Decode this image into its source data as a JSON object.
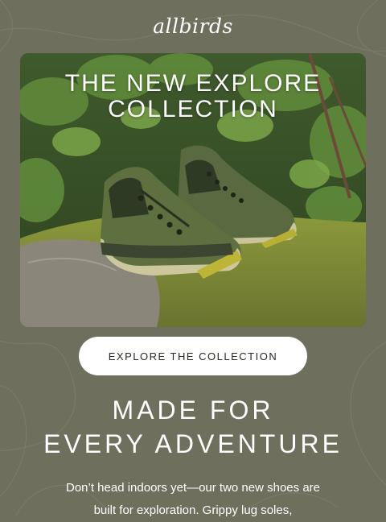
{
  "brand": {
    "logo_text": "allbirds"
  },
  "hero": {
    "title_line1": "THE NEW EXPLORE",
    "title_line2": "COLLECTION",
    "image": "green-trail-shoes-on-mossy-rock"
  },
  "cta": {
    "label": "EXPLORE THE COLLECTION"
  },
  "section": {
    "headline_line1": "MADE FOR",
    "headline_line2": "EVERY ADVENTURE",
    "body_line1": "Don’t head indoors yet—our two new shoes are",
    "body_line2": "built for exploration. Grippy lug soles,"
  },
  "colors": {
    "background": "#6f6f5e",
    "button_bg": "#ffffff",
    "button_text": "#2a2a22",
    "text": "#ffffff"
  }
}
